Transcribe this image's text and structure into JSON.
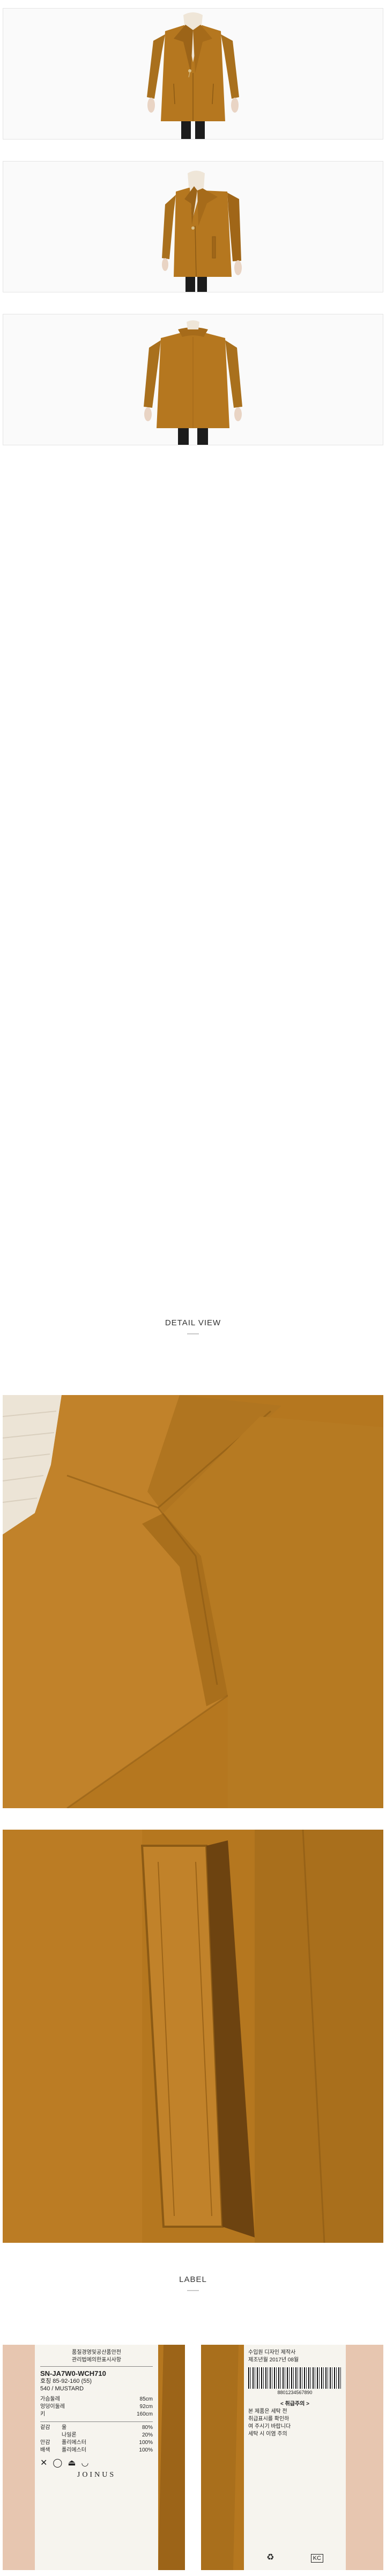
{
  "sections": {
    "detail_title": "DETAIL VIEW",
    "label_title": "LABEL"
  },
  "photos": [
    {
      "view": "front"
    },
    {
      "view": "side"
    },
    {
      "view": "back"
    },
    {
      "view": "collar-closeup"
    },
    {
      "view": "pocket-closeup"
    }
  ],
  "label_left": {
    "header_lines": [
      "품질경영및공산품안전",
      "관리법에의한표시사항"
    ],
    "style_code": "SN-JA7W0-WCH710",
    "size_line": "호칭 85-92-160 (55)",
    "color_line": "540 / MUSTARD",
    "fiber_rows": [
      {
        "part": "겉감",
        "material": "울",
        "pct": "80%"
      },
      {
        "part": "",
        "material": "나일론",
        "pct": "20%"
      },
      {
        "part": "안감",
        "material": "폴리에스터",
        "pct": "100%"
      },
      {
        "part": "배색",
        "material": "폴리에스터",
        "pct": "100%"
      }
    ],
    "measure_rows": [
      {
        "label": "가슴둘레",
        "value": "85cm"
      },
      {
        "label": "엉덩이둘레",
        "value": "92cm"
      },
      {
        "label": "키",
        "value": "160cm"
      }
    ],
    "brand": "JOINUS"
  },
  "label_right": {
    "top_lines": [
      "수입원 디자인 제작사",
      "제조년월 2017년 08월"
    ],
    "barcode_number": "8801234567890",
    "care_title": "< 취급주의 >",
    "care_lines": [
      "본 제품은 세탁 전",
      "취급표시를 확인하",
      "여 주시기 바랍니다",
      "세탁 시 이염 주의"
    ]
  },
  "colors": {
    "coat": "#b5771f",
    "coat_dark": "#8c5a14",
    "coat_light": "#c98c2e",
    "skin": "#e9d4c4",
    "neck": "#efe6d8",
    "pants": "#1c1c1c"
  }
}
